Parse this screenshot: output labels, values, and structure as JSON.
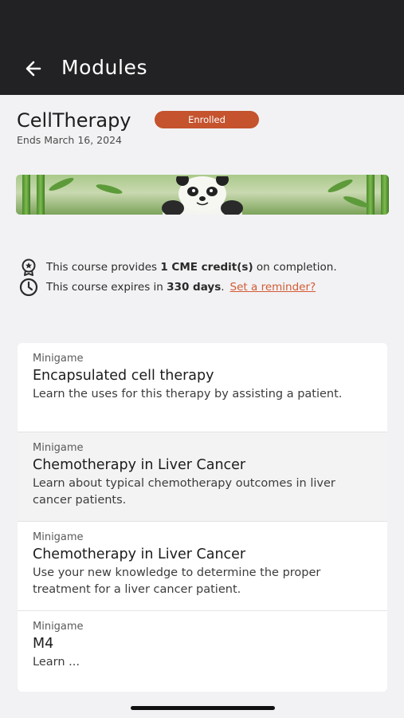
{
  "header": {
    "title": "Modules",
    "back_icon": "arrow-left-icon"
  },
  "course": {
    "title": "CellTherapy",
    "badge": "Enrolled",
    "ends": "Ends March 16, 2024"
  },
  "info": {
    "credit_prefix": "This course provides ",
    "credit_bold": "1 CME credit(s)",
    "credit_suffix": " on completion.",
    "expire_prefix": "This course expires in ",
    "expire_bold": "330 days",
    "expire_suffix": ".",
    "reminder_link": "Set a reminder?"
  },
  "modules": [
    {
      "kind": "Minigame",
      "title": "Encapsulated cell therapy",
      "desc": "Learn the uses for this therapy by assisting a patient."
    },
    {
      "kind": "Minigame",
      "title": "Chemotherapy in Liver Cancer",
      "desc": "Learn about typical chemotherapy outcomes in liver cancer patients."
    },
    {
      "kind": "Minigame",
      "title": "Chemotherapy in Liver Cancer",
      "desc": "Use your new knowledge to determine the proper treatment for a liver cancer patient."
    },
    {
      "kind": "Minigame",
      "title": "M4",
      "desc": "Learn ..."
    }
  ],
  "colors": {
    "appbar": "#222224",
    "accent": "#c4532e",
    "link": "#d25b34",
    "background": "#f2f2f4"
  }
}
